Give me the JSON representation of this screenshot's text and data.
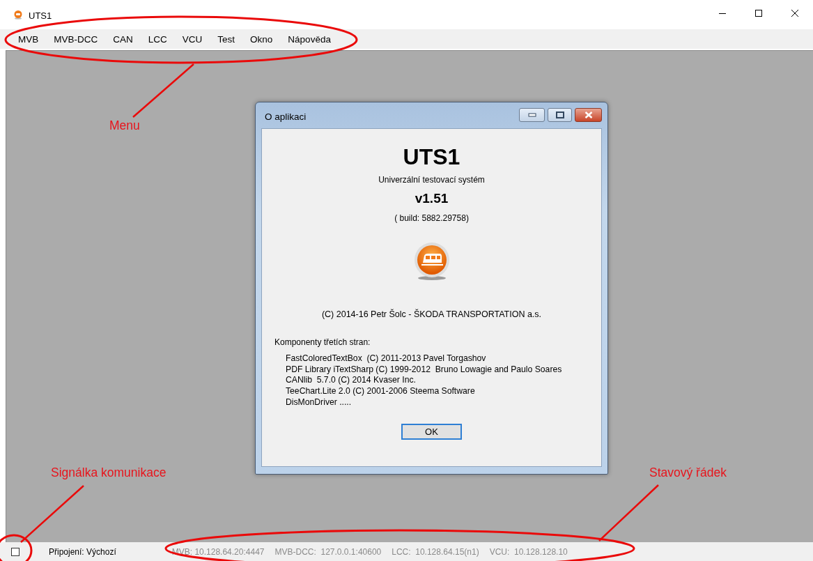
{
  "window": {
    "title": "UTS1"
  },
  "menu": [
    {
      "label": "MVB"
    },
    {
      "label": "MVB-DCC"
    },
    {
      "label": "CAN"
    },
    {
      "label": "LCC"
    },
    {
      "label": "VCU"
    },
    {
      "label": "Test"
    },
    {
      "label": "Okno"
    },
    {
      "label": "Nápověda"
    }
  ],
  "dialog": {
    "title": "O aplikaci",
    "app_name": "UTS1",
    "subtitle": "Univerzální testovací systém",
    "version": "v1.51",
    "build": "( build: 5882.29758)",
    "copyright": "(C) 2014-16 Petr Šolc - ŠKODA TRANSPORTATION a.s.",
    "components_heading": "Komponenty třetích stran:",
    "components": [
      "FastColoredTextBox  (C) 2011-2013 Pavel Torgashov",
      "PDF Library iTextSharp (C) 1999-2012  Bruno Lowagie and Paulo Soares",
      "CANlib  5.7.0 (C) 2014 Kvaser Inc.",
      "TeeChart.Lite 2.0 (C) 2001-2006 Steema Software",
      "DisMonDriver ....."
    ],
    "ok_button": "OK"
  },
  "status_bar": {
    "indicator": {
      "checked": false
    },
    "items": [
      {
        "text": "Připojení: Výchozí",
        "disabled": false
      },
      {
        "text": "MVB: 10.128.64.20:4447",
        "disabled": true
      },
      {
        "text": "MVB-DCC:  127.0.0.1:40600",
        "disabled": true
      },
      {
        "text": "LCC:  10.128.64.15(n1)",
        "disabled": true
      },
      {
        "text": "VCU:  10.128.128.10",
        "disabled": true
      }
    ]
  },
  "annotations": [
    {
      "label": "Menu"
    },
    {
      "label": "Signálka komunikace"
    },
    {
      "label": "Stavový řádek"
    }
  ]
}
